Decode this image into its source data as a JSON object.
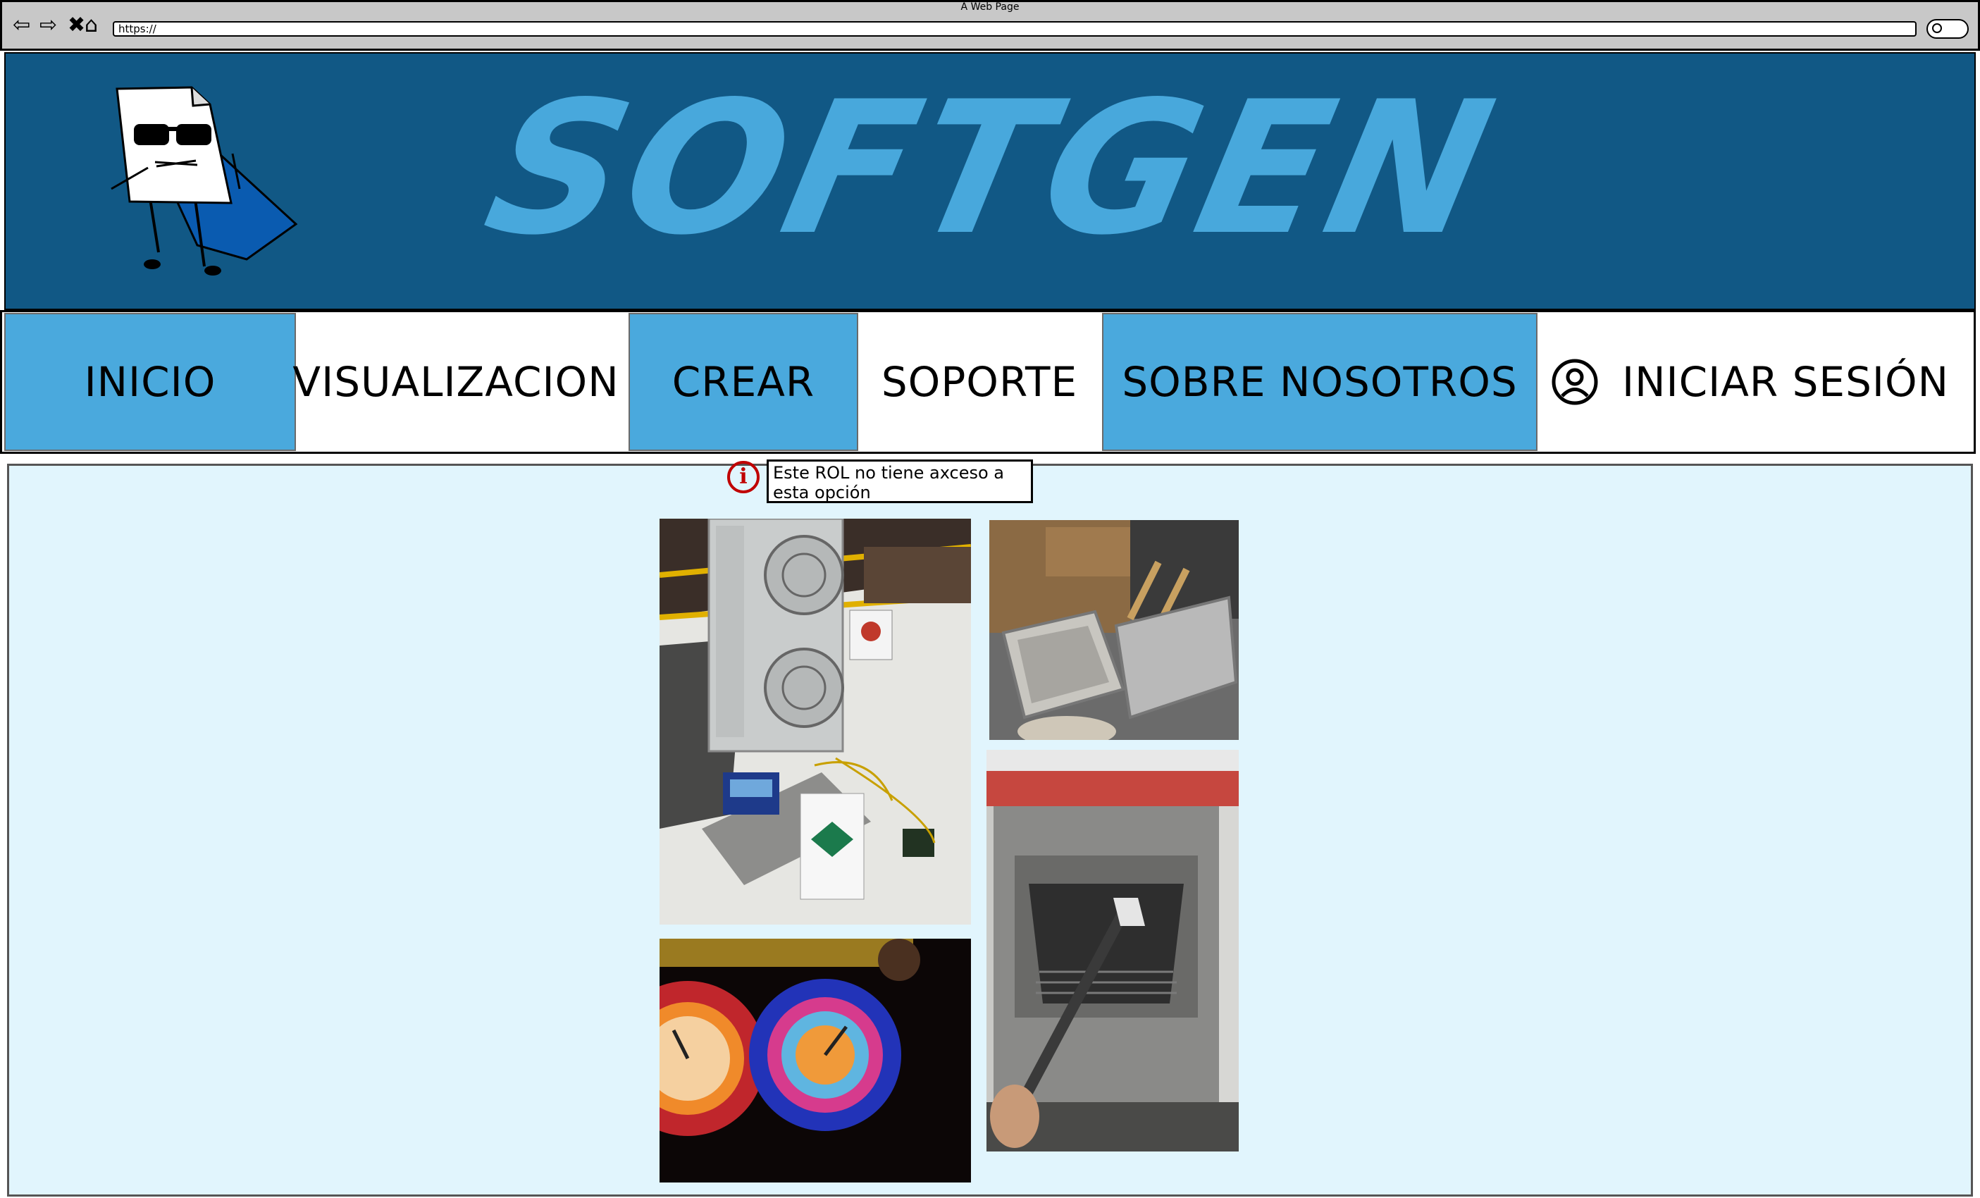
{
  "browser": {
    "window_title": "A Web Page",
    "url": "https://"
  },
  "header": {
    "brand": "SOFTGEN",
    "colors": {
      "header_bg": "#115885",
      "brand_text": "#48a8dc",
      "nav_active": "#4aa9dd"
    }
  },
  "nav": {
    "inicio": "INICIO",
    "visualizacion": "VISUALIZACION",
    "crear": "CREAR",
    "soporte": "SOPORTE",
    "sobre_nosotros": "SOBRE NOSOTROS",
    "iniciar_sesion": "INICIAR SESIÓN"
  },
  "tooltip": {
    "icon": "info-icon",
    "text": "Este ROL no tiene axceso a esta opción"
  },
  "content": {
    "background": "#e1f5fd"
  }
}
